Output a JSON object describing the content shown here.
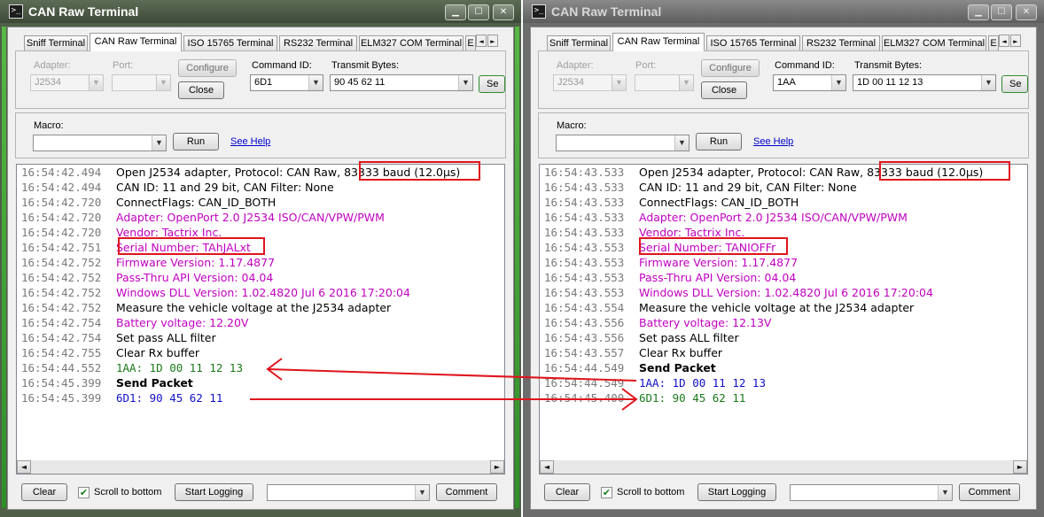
{
  "colors": {
    "timestamp": "#7a7a7a",
    "normal": "#000000",
    "info": "#c000c0",
    "tx": "#1010c8",
    "rx": "#1a7a1a",
    "highlight": "#e0141c"
  },
  "icons": {
    "app": "terminal-icon",
    "minimize": "minimize-icon",
    "maximize": "maximize-icon",
    "close": "close-icon",
    "dropdown": "chevron-down-icon",
    "scroll_left": "chevron-left-icon",
    "scroll_right": "chevron-right-icon"
  },
  "windows": [
    {
      "title": "CAN Raw Terminal",
      "appicon_glyph": ">_",
      "tabs": [
        "Sniff Terminal",
        "CAN Raw Terminal",
        "ISO 15765 Terminal",
        "RS232 Terminal",
        "ELM327 COM Terminal",
        "E"
      ],
      "tab_scroll_left": "◄",
      "tab_scroll_right": "►",
      "adapter_label": "Adapter:",
      "adapter_value": "J2534",
      "port_label": "Port:",
      "port_value": "",
      "configure_label": "Configure",
      "close_label": "Close",
      "command_id_label": "Command ID:",
      "command_id_value": "6D1",
      "transmit_label": "Transmit Bytes:",
      "transmit_value": "90 45 62 11",
      "send_label": "Se",
      "macro_label": "Macro:",
      "macro_value": "",
      "run_label": "Run",
      "help_label": "See Help",
      "log": [
        {
          "ts": "16:54:42.494",
          "msg": "Open J2534 adapter,  Protocol: CAN Raw, 83333 baud (12.0µs)",
          "kind": "normal"
        },
        {
          "ts": "16:54:42.494",
          "msg": "CAN ID: 11 and 29 bit, CAN Filter: None",
          "kind": "normal"
        },
        {
          "ts": "16:54:42.720",
          "msg": "ConnectFlags: CAN_ID_BOTH",
          "kind": "normal"
        },
        {
          "ts": "16:54:42.720",
          "msg": "Adapter: OpenPort 2.0 J2534 ISO/CAN/VPW/PWM",
          "kind": "info"
        },
        {
          "ts": "16:54:42.720",
          "msg": "Vendor: Tactrix Inc.",
          "kind": "info"
        },
        {
          "ts": "16:54:42.751",
          "msg": "Serial Number: TAhJALxt",
          "kind": "info"
        },
        {
          "ts": "16:54:42.752",
          "msg": "Firmware Version: 1.17.4877",
          "kind": "info"
        },
        {
          "ts": "16:54:42.752",
          "msg": "Pass-Thru API Version: 04.04",
          "kind": "info"
        },
        {
          "ts": "16:54:42.752",
          "msg": "Windows DLL Version: 1.02.4820 Jul  6 2016 17:20:04",
          "kind": "info"
        },
        {
          "ts": "16:54:42.752",
          "msg": "Measure the vehicle voltage at the J2534 adapter",
          "kind": "normal"
        },
        {
          "ts": "16:54:42.754",
          "msg": "Battery voltage: 12.20V",
          "kind": "info"
        },
        {
          "ts": "16:54:42.754",
          "msg": "Set pass ALL filter",
          "kind": "normal"
        },
        {
          "ts": "16:54:42.755",
          "msg": "Clear Rx buffer",
          "kind": "normal"
        },
        {
          "ts": "16:54:44.552",
          "msg": "1AA: 1D 00 11 12 13",
          "kind": "rx"
        },
        {
          "ts": "16:54:45.399",
          "msg": "Send Packet",
          "kind": "bold"
        },
        {
          "ts": "16:54:45.399",
          "msg": "6D1: 90 45 62 11",
          "kind": "tx"
        }
      ],
      "clear_label": "Clear",
      "scroll_label": "Scroll to bottom",
      "scroll_checked": true,
      "logging_label": "Start Logging",
      "comment_value": "",
      "comment_label": "Comment"
    },
    {
      "title": "CAN Raw Terminal",
      "appicon_glyph": ">_",
      "tabs": [
        "Sniff Terminal",
        "CAN Raw Terminal",
        "ISO 15765 Terminal",
        "RS232 Terminal",
        "ELM327 COM Terminal",
        "E"
      ],
      "tab_scroll_left": "◄",
      "tab_scroll_right": "►",
      "adapter_label": "Adapter:",
      "adapter_value": "J2534",
      "port_label": "Port:",
      "port_value": "",
      "configure_label": "Configure",
      "close_label": "Close",
      "command_id_label": "Command ID:",
      "command_id_value": "1AA",
      "transmit_label": "Transmit Bytes:",
      "transmit_value": "1D 00 11 12 13",
      "send_label": "Se",
      "macro_label": "Macro:",
      "macro_value": "",
      "run_label": "Run",
      "help_label": "See Help",
      "log": [
        {
          "ts": "16:54:43.533",
          "msg": "Open J2534 adapter,  Protocol: CAN Raw, 83333 baud (12.0µs)",
          "kind": "normal"
        },
        {
          "ts": "16:54:43.533",
          "msg": "CAN ID: 11 and 29 bit, CAN Filter: None",
          "kind": "normal"
        },
        {
          "ts": "16:54:43.533",
          "msg": "ConnectFlags: CAN_ID_BOTH",
          "kind": "normal"
        },
        {
          "ts": "16:54:43.533",
          "msg": "Adapter: OpenPort 2.0 J2534 ISO/CAN/VPW/PWM",
          "kind": "info"
        },
        {
          "ts": "16:54:43.533",
          "msg": "Vendor: Tactrix Inc.",
          "kind": "info"
        },
        {
          "ts": "16:54:43.553",
          "msg": "Serial Number: TANIOFFr",
          "kind": "info"
        },
        {
          "ts": "16:54:43.553",
          "msg": "Firmware Version: 1.17.4877",
          "kind": "info"
        },
        {
          "ts": "16:54:43.553",
          "msg": "Pass-Thru API Version: 04.04",
          "kind": "info"
        },
        {
          "ts": "16:54:43.553",
          "msg": "Windows DLL Version: 1.02.4820 Jul  6 2016 17:20:04",
          "kind": "info"
        },
        {
          "ts": "16:54:43.554",
          "msg": "Measure the vehicle voltage at the J2534 adapter",
          "kind": "normal"
        },
        {
          "ts": "16:54:43.556",
          "msg": "Battery voltage: 12.13V",
          "kind": "info"
        },
        {
          "ts": "16:54:43.556",
          "msg": "Set pass ALL filter",
          "kind": "normal"
        },
        {
          "ts": "16:54:43.557",
          "msg": "Clear Rx buffer",
          "kind": "normal"
        },
        {
          "ts": "16:54:44.549",
          "msg": "Send Packet",
          "kind": "bold"
        },
        {
          "ts": "16:54:44.549",
          "msg": "1AA: 1D 00 11 12 13",
          "kind": "tx"
        },
        {
          "ts": "16:54:45.400",
          "msg": "6D1: 90 45 62 11",
          "kind": "rx"
        }
      ],
      "clear_label": "Clear",
      "scroll_label": "Scroll to bottom",
      "scroll_checked": true,
      "logging_label": "Start Logging",
      "comment_value": "",
      "comment_label": "Comment"
    }
  ]
}
